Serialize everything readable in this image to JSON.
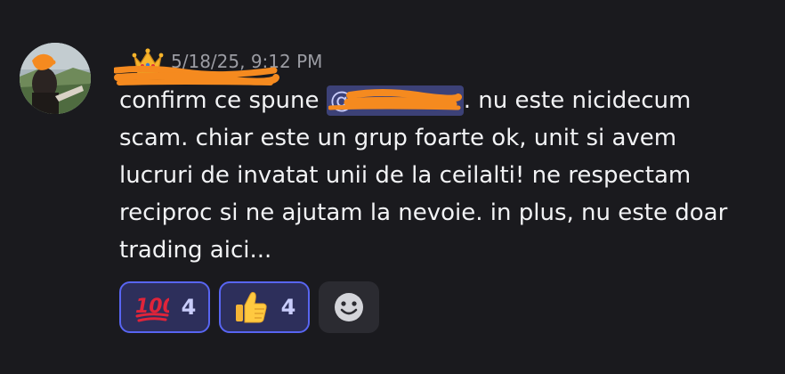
{
  "message": {
    "author": {
      "name": "",
      "name_redacted": true,
      "role_icon": "crown-icon"
    },
    "timestamp": "5/18/25, 9:12 PM",
    "content": {
      "before_mention": "confirm ce spune ",
      "mention": "@",
      "mention_redacted": true,
      "after_mention": ". nu este nicidecum scam. chiar este un grup foarte ok, unit si avem lucruri de invatat unii de la ceilalti! ne respectam reciproc si ne ajutam la nevoie. in plus, nu este doar trading aici..."
    },
    "reactions": [
      {
        "emoji": "hundred-points-icon",
        "count": "4"
      },
      {
        "emoji": "thumbs-up-icon",
        "count": "4"
      }
    ],
    "add_reaction_icon": "smiley-add-reaction-icon"
  },
  "colors": {
    "background": "#1a1a1e",
    "text": "#f2f3f5",
    "timestamp": "#9b9ca3",
    "mention_bg": "#3c4177",
    "reaction_border": "#5865f2",
    "reaction_bg": "#2d2f5b",
    "redaction": "#f58a1f"
  }
}
